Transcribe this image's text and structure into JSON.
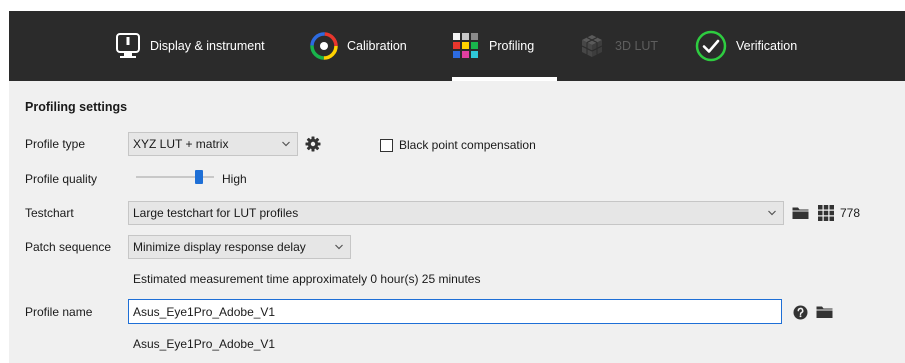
{
  "tabs": [
    {
      "label": "Display & instrument",
      "icon": "display-icon",
      "state": "normal"
    },
    {
      "label": "Calibration",
      "icon": "calibration-icon",
      "state": "normal"
    },
    {
      "label": "Profiling",
      "icon": "profiling-grid-icon",
      "state": "active"
    },
    {
      "label": "3D LUT",
      "icon": "lut-cube-icon",
      "state": "disabled"
    },
    {
      "label": "Verification",
      "icon": "checkmark-circle-icon",
      "state": "normal"
    }
  ],
  "profiling": {
    "section_title": "Profiling settings",
    "profile_type": {
      "label": "Profile type",
      "value": "XYZ LUT + matrix",
      "black_point_compensation_label": "Black point compensation",
      "black_point_compensation_checked": false
    },
    "profile_quality": {
      "label": "Profile quality",
      "value_text": "High",
      "level_fraction": 0.82
    },
    "testchart": {
      "label": "Testchart",
      "value": "Large testchart for LUT profiles",
      "patch_count": "778"
    },
    "patch_sequence": {
      "label": "Patch sequence",
      "value": "Minimize display response delay"
    },
    "estimated_time": "Estimated measurement time approximately 0 hour(s) 25 minutes",
    "profile_name": {
      "label": "Profile name",
      "value": "Asus_Eye1Pro_Adobe_V1",
      "preview": "Asus_Eye1Pro_Adobe_V1"
    }
  },
  "colors": {
    "topbar_bg": "#2b2b2b",
    "panel_bg": "#f0f0f0",
    "accent": "#1e6fd6",
    "verification_green": "#2ecc40"
  }
}
